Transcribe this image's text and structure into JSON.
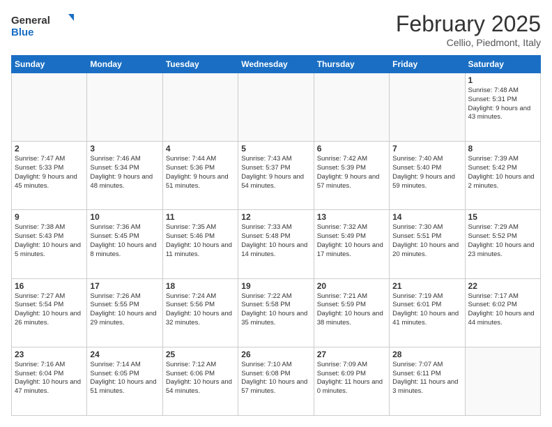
{
  "header": {
    "logo_general": "General",
    "logo_blue": "Blue",
    "month_title": "February 2025",
    "location": "Cellio, Piedmont, Italy"
  },
  "weekdays": [
    "Sunday",
    "Monday",
    "Tuesday",
    "Wednesday",
    "Thursday",
    "Friday",
    "Saturday"
  ],
  "weeks": [
    [
      {
        "day": "",
        "info": ""
      },
      {
        "day": "",
        "info": ""
      },
      {
        "day": "",
        "info": ""
      },
      {
        "day": "",
        "info": ""
      },
      {
        "day": "",
        "info": ""
      },
      {
        "day": "",
        "info": ""
      },
      {
        "day": "1",
        "info": "Sunrise: 7:48 AM\nSunset: 5:31 PM\nDaylight: 9 hours and 43 minutes."
      }
    ],
    [
      {
        "day": "2",
        "info": "Sunrise: 7:47 AM\nSunset: 5:33 PM\nDaylight: 9 hours and 45 minutes."
      },
      {
        "day": "3",
        "info": "Sunrise: 7:46 AM\nSunset: 5:34 PM\nDaylight: 9 hours and 48 minutes."
      },
      {
        "day": "4",
        "info": "Sunrise: 7:44 AM\nSunset: 5:36 PM\nDaylight: 9 hours and 51 minutes."
      },
      {
        "day": "5",
        "info": "Sunrise: 7:43 AM\nSunset: 5:37 PM\nDaylight: 9 hours and 54 minutes."
      },
      {
        "day": "6",
        "info": "Sunrise: 7:42 AM\nSunset: 5:39 PM\nDaylight: 9 hours and 57 minutes."
      },
      {
        "day": "7",
        "info": "Sunrise: 7:40 AM\nSunset: 5:40 PM\nDaylight: 9 hours and 59 minutes."
      },
      {
        "day": "8",
        "info": "Sunrise: 7:39 AM\nSunset: 5:42 PM\nDaylight: 10 hours and 2 minutes."
      }
    ],
    [
      {
        "day": "9",
        "info": "Sunrise: 7:38 AM\nSunset: 5:43 PM\nDaylight: 10 hours and 5 minutes."
      },
      {
        "day": "10",
        "info": "Sunrise: 7:36 AM\nSunset: 5:45 PM\nDaylight: 10 hours and 8 minutes."
      },
      {
        "day": "11",
        "info": "Sunrise: 7:35 AM\nSunset: 5:46 PM\nDaylight: 10 hours and 11 minutes."
      },
      {
        "day": "12",
        "info": "Sunrise: 7:33 AM\nSunset: 5:48 PM\nDaylight: 10 hours and 14 minutes."
      },
      {
        "day": "13",
        "info": "Sunrise: 7:32 AM\nSunset: 5:49 PM\nDaylight: 10 hours and 17 minutes."
      },
      {
        "day": "14",
        "info": "Sunrise: 7:30 AM\nSunset: 5:51 PM\nDaylight: 10 hours and 20 minutes."
      },
      {
        "day": "15",
        "info": "Sunrise: 7:29 AM\nSunset: 5:52 PM\nDaylight: 10 hours and 23 minutes."
      }
    ],
    [
      {
        "day": "16",
        "info": "Sunrise: 7:27 AM\nSunset: 5:54 PM\nDaylight: 10 hours and 26 minutes."
      },
      {
        "day": "17",
        "info": "Sunrise: 7:26 AM\nSunset: 5:55 PM\nDaylight: 10 hours and 29 minutes."
      },
      {
        "day": "18",
        "info": "Sunrise: 7:24 AM\nSunset: 5:56 PM\nDaylight: 10 hours and 32 minutes."
      },
      {
        "day": "19",
        "info": "Sunrise: 7:22 AM\nSunset: 5:58 PM\nDaylight: 10 hours and 35 minutes."
      },
      {
        "day": "20",
        "info": "Sunrise: 7:21 AM\nSunset: 5:59 PM\nDaylight: 10 hours and 38 minutes."
      },
      {
        "day": "21",
        "info": "Sunrise: 7:19 AM\nSunset: 6:01 PM\nDaylight: 10 hours and 41 minutes."
      },
      {
        "day": "22",
        "info": "Sunrise: 7:17 AM\nSunset: 6:02 PM\nDaylight: 10 hours and 44 minutes."
      }
    ],
    [
      {
        "day": "23",
        "info": "Sunrise: 7:16 AM\nSunset: 6:04 PM\nDaylight: 10 hours and 47 minutes."
      },
      {
        "day": "24",
        "info": "Sunrise: 7:14 AM\nSunset: 6:05 PM\nDaylight: 10 hours and 51 minutes."
      },
      {
        "day": "25",
        "info": "Sunrise: 7:12 AM\nSunset: 6:06 PM\nDaylight: 10 hours and 54 minutes."
      },
      {
        "day": "26",
        "info": "Sunrise: 7:10 AM\nSunset: 6:08 PM\nDaylight: 10 hours and 57 minutes."
      },
      {
        "day": "27",
        "info": "Sunrise: 7:09 AM\nSunset: 6:09 PM\nDaylight: 11 hours and 0 minutes."
      },
      {
        "day": "28",
        "info": "Sunrise: 7:07 AM\nSunset: 6:11 PM\nDaylight: 11 hours and 3 minutes."
      },
      {
        "day": "",
        "info": ""
      }
    ]
  ]
}
